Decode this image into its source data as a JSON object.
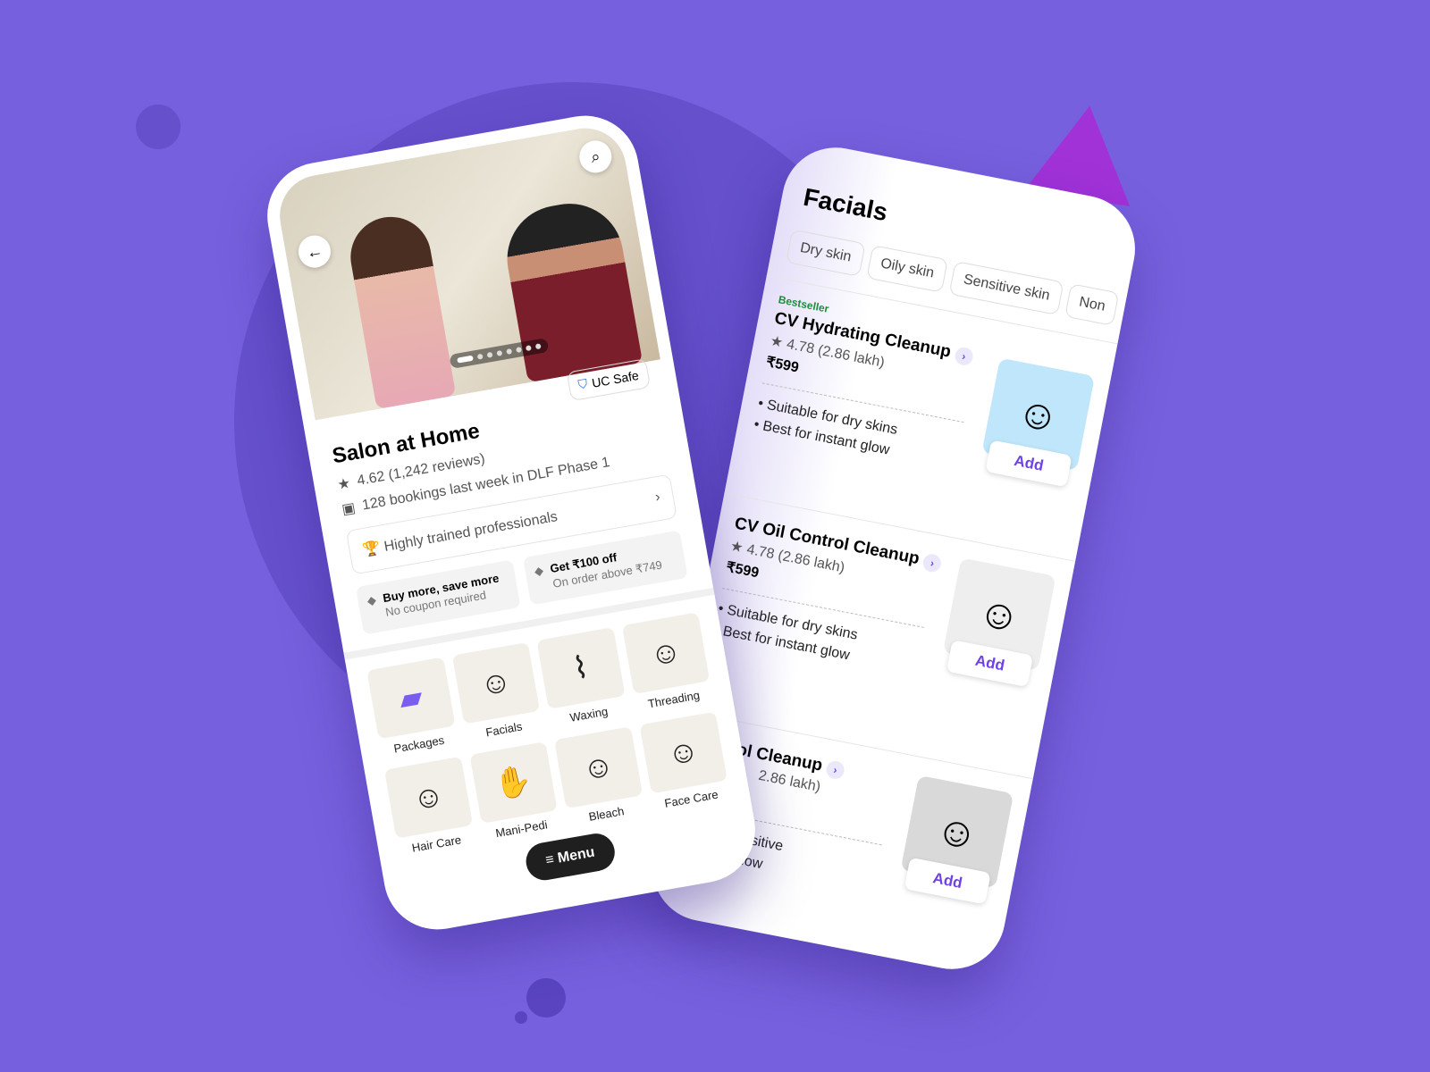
{
  "colors": {
    "background": "#7760dd",
    "accent": "#6e42e5",
    "bestseller": "#1e8e3e"
  },
  "left": {
    "back_icon": "arrow-left-icon",
    "search_icon": "search-icon",
    "uc_safe": "UC Safe",
    "title": "Salon at Home",
    "rating": "4.62 (1,242 reviews)",
    "bookings": "128 bookings last week in DLF Phase 1",
    "professionals": "Highly trained professionals",
    "offers": [
      {
        "title": "Buy more, save more",
        "sub": "No coupon required"
      },
      {
        "title": "Get ₹100 off",
        "sub": "On order above ₹749"
      }
    ],
    "categories": [
      "Packages",
      "Facials",
      "Waxing",
      "Threading",
      "Hair Care",
      "Mani-Pedi",
      "Bleach",
      "Face Care"
    ],
    "menu": "Menu",
    "carousel_slides": 8,
    "carousel_active": 1
  },
  "right": {
    "title": "Facials",
    "chips": [
      "Dry skin",
      "Oily skin",
      "Sensitive skin",
      "Non"
    ],
    "items": [
      {
        "badge": "Bestseller",
        "name": "CV Hydrating Cleanup",
        "rating": "4.78 (2.86 lakh)",
        "price": "₹599",
        "bullets": [
          "Suitable for dry skins",
          "Best for instant glow"
        ],
        "add": "Add"
      },
      {
        "badge": "",
        "name": "CV Oil Control Cleanup",
        "rating": "4.78 (2.86 lakh)",
        "price": "₹599",
        "bullets": [
          "Suitable for dry skins",
          "Best for instant glow"
        ],
        "add": "Add"
      },
      {
        "badge": "",
        "name": "Control Cleanup",
        "rating": "2.86 lakh)",
        "price": "",
        "bullets": [
          "or non - sensitive",
          "or instant glow"
        ],
        "add": "Add"
      }
    ]
  }
}
